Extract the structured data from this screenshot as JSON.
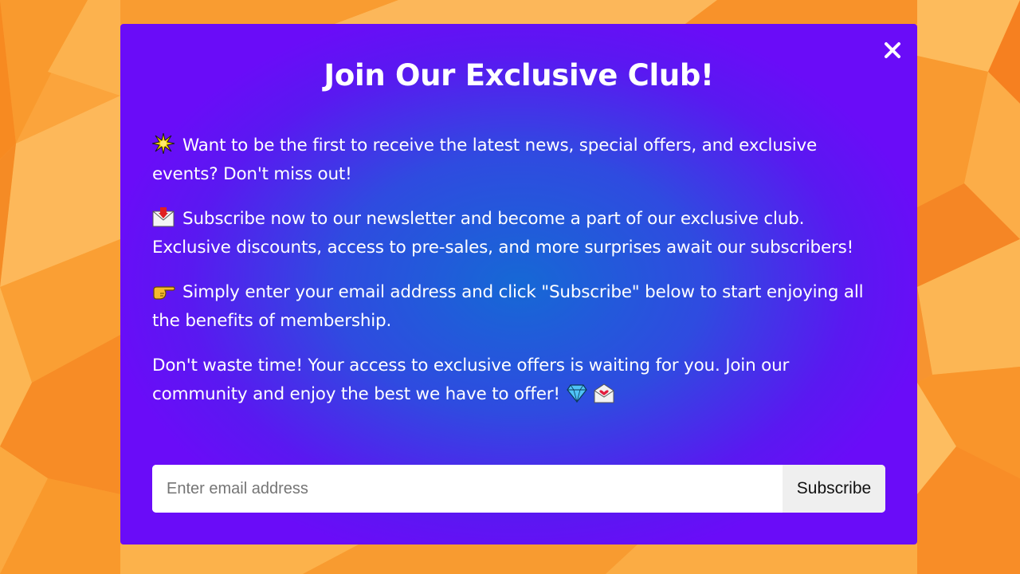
{
  "colors": {
    "background_accent": "#fba43c",
    "modal_center": "#1668d5",
    "modal_edge": "#6a0cf8",
    "text": "#ffffff",
    "button_bg": "#efefef"
  },
  "modal": {
    "title": "Join Our Exclusive Club!",
    "close_icon": "close-x-icon",
    "paragraphs": [
      {
        "icon": "sparkle-star-icon",
        "text": "Want to be the first to receive the latest news, special offers, and exclusive events? Don't miss out!"
      },
      {
        "icon": "envelope-icon",
        "text": "Subscribe now to our newsletter and become a part of our exclusive club. Exclusive discounts, access to pre-sales, and more surprises await our subscribers!"
      },
      {
        "icon": "pointing-right-hand-icon",
        "text": "Simply enter your email address and click \"Subscribe\" below to start enjoying all the benefits of membership."
      },
      {
        "text": "Don't waste time! Your access to exclusive offers is waiting for you. Join our community and enjoy the best we have to offer!",
        "trailing_icons": [
          "gem-icon",
          "love-letter-icon"
        ]
      }
    ]
  },
  "form": {
    "email_placeholder": "Enter email address",
    "email_value": "",
    "subscribe_label": "Subscribe"
  }
}
